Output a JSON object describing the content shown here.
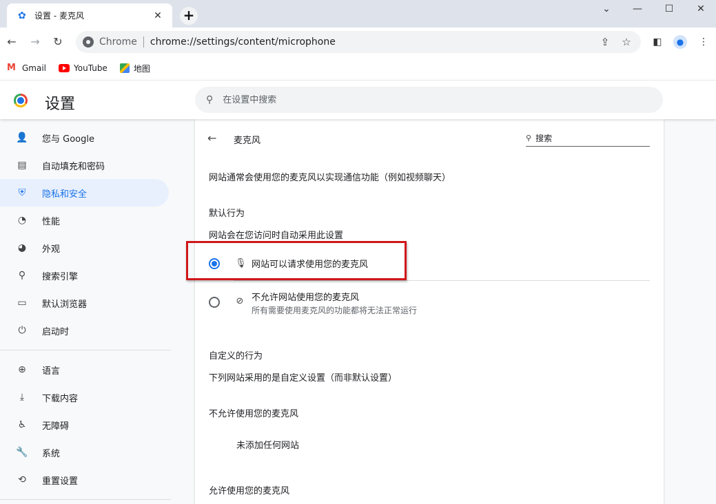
{
  "tab": {
    "title": "设置 - 麦克风"
  },
  "toolbar": {
    "chrome_label": "Chrome",
    "url": "chrome://settings/content/microphone"
  },
  "bookmarks": [
    {
      "label": "Gmail",
      "icon": "gmail-icon"
    },
    {
      "label": "YouTube",
      "icon": "youtube-icon"
    },
    {
      "label": "地图",
      "icon": "maps-icon"
    }
  ],
  "header": {
    "title": "设置",
    "search_placeholder": "在设置中搜索"
  },
  "sidebar": {
    "items": [
      {
        "label": "您与 Google",
        "icon": "person-icon",
        "active": false
      },
      {
        "label": "自动填充和密码",
        "icon": "clipboard-icon",
        "active": false
      },
      {
        "label": "隐私和安全",
        "icon": "shield-icon",
        "active": true
      },
      {
        "label": "性能",
        "icon": "speedometer-icon",
        "active": false
      },
      {
        "label": "外观",
        "icon": "palette-icon",
        "active": false
      },
      {
        "label": "搜索引擎",
        "icon": "search-icon",
        "active": false
      },
      {
        "label": "默认浏览器",
        "icon": "browser-window-icon",
        "active": false
      },
      {
        "label": "启动时",
        "icon": "power-icon",
        "active": false
      },
      {
        "label": "语言",
        "icon": "globe-icon",
        "active": false
      },
      {
        "label": "下载内容",
        "icon": "download-icon",
        "active": false
      },
      {
        "label": "无障碍",
        "icon": "accessibility-icon",
        "active": false
      },
      {
        "label": "系统",
        "icon": "wrench-icon",
        "active": false
      },
      {
        "label": "重置设置",
        "icon": "history-icon",
        "active": false
      }
    ]
  },
  "content": {
    "title": "麦克风",
    "search_placeholder": "搜索",
    "description": "网站通常会使用您的麦克风以实现通信功能（例如视频聊天）",
    "default_behavior": "默认行为",
    "default_behavior_sub": "网站会在您访问时自动采用此设置",
    "option_allow": "网站可以请求使用您的麦克风",
    "option_block": "不允许网站使用您的麦克风",
    "option_block_sub": "所有需要使用麦克风的功能都将无法正常运行",
    "custom_behavior": "自定义的行为",
    "custom_behavior_sub": "下列网站采用的是自定义设置（而非默认设置）",
    "not_allowed_heading": "不允许使用您的麦克风",
    "no_sites": "未添加任何网站",
    "allowed_heading": "允许使用您的麦克风"
  },
  "colors": {
    "accent": "#1a73e8",
    "highlight_box": "#d0171a"
  }
}
